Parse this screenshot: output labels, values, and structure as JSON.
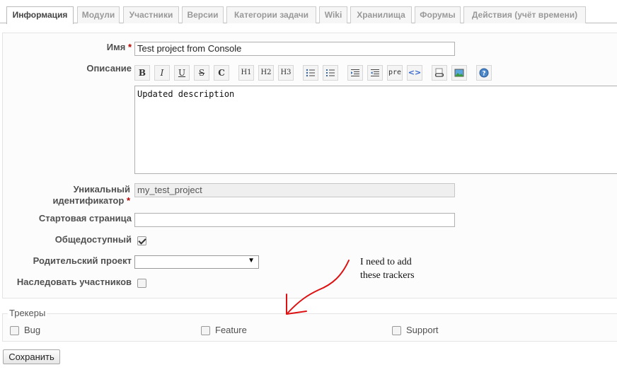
{
  "tabs": [
    {
      "label": "Информация",
      "selected": true
    },
    {
      "label": "Модули"
    },
    {
      "label": "Участники"
    },
    {
      "label": "Версии"
    },
    {
      "label": "Категории задачи"
    },
    {
      "label": "Wiki"
    },
    {
      "label": "Хранилища"
    },
    {
      "label": "Форумы"
    },
    {
      "label": "Действия (учёт времени)"
    }
  ],
  "form": {
    "name_label": "Имя",
    "required_mark": "*",
    "name_value": "Test project from Console",
    "description_label": "Описание",
    "description_value": "Updated description",
    "identifier_label_1": "Уникальный",
    "identifier_label_2": "идентификатор",
    "identifier_value": "my_test_project",
    "homepage_label": "Стартовая страница",
    "homepage_value": "",
    "public_label": "Общедоступный",
    "public_checked": true,
    "parent_label": "Родительский проект",
    "parent_value": "",
    "inherit_label": "Наследовать участников",
    "inherit_checked": false
  },
  "toolbar": {
    "buttons": [
      "B",
      "I",
      "U",
      "S",
      "C",
      "H1",
      "H2",
      "H3",
      "ul-list-icon",
      "ol-list-icon",
      "indent-icon",
      "outdent-icon",
      "pre",
      "code-icon",
      "link-icon",
      "image-icon",
      "help-icon"
    ]
  },
  "trackers": {
    "legend": "Трекеры",
    "items": [
      {
        "label": "Bug",
        "checked": false
      },
      {
        "label": "Feature",
        "checked": false
      },
      {
        "label": "Support",
        "checked": false
      }
    ]
  },
  "save_button": "Сохранить",
  "annotation": {
    "line1": "I need to add",
    "line2": "these trackers",
    "color": "#dd1111"
  }
}
